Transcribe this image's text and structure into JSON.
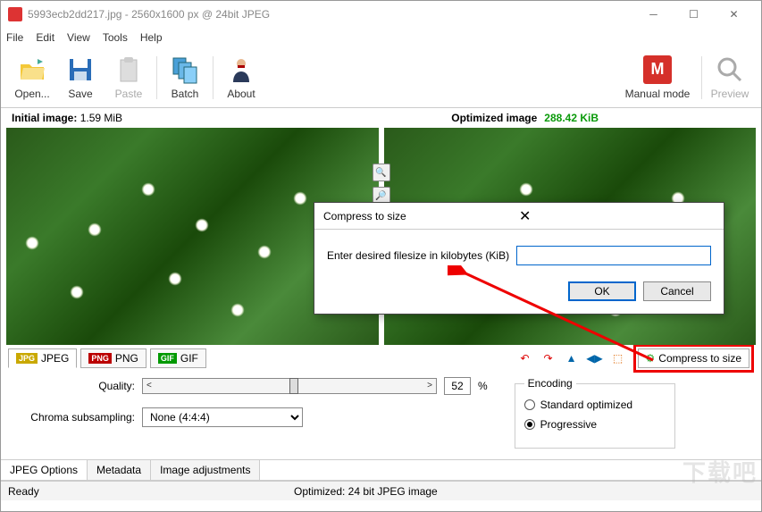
{
  "window": {
    "title": "5993ecb2dd217.jpg - 2560x1600 px @ 24bit JPEG"
  },
  "menu": {
    "file": "File",
    "edit": "Edit",
    "view": "View",
    "tools": "Tools",
    "help": "Help"
  },
  "toolbar": {
    "open": "Open...",
    "save": "Save",
    "paste": "Paste",
    "batch": "Batch",
    "about": "About",
    "manual_mode": "Manual mode",
    "preview": "Preview"
  },
  "sizes": {
    "initial_label": "Initial image:",
    "initial_value": "1.59 MiB",
    "optimized_label": "Optimized image",
    "optimized_value": "288.42 KiB"
  },
  "format_tabs": {
    "jpeg": "JPEG",
    "png": "PNG",
    "gif": "GIF"
  },
  "compress_button": "Compress to size",
  "options": {
    "quality_label": "Quality:",
    "quality_value": "52",
    "percent": "%",
    "chroma_label": "Chroma subsampling:",
    "chroma_value": "None (4:4:4)"
  },
  "encoding": {
    "legend": "Encoding",
    "standard": "Standard optimized",
    "progressive": "Progressive"
  },
  "bottom_tabs": {
    "jpeg": "JPEG Options",
    "meta": "Metadata",
    "adjust": "Image adjustments"
  },
  "status": {
    "ready": "Ready",
    "optimized": "Optimized: 24 bit JPEG image"
  },
  "dialog": {
    "title": "Compress to size",
    "prompt": "Enter desired filesize in kilobytes (KiB)",
    "ok": "OK",
    "cancel": "Cancel"
  },
  "watermark": "下载吧"
}
